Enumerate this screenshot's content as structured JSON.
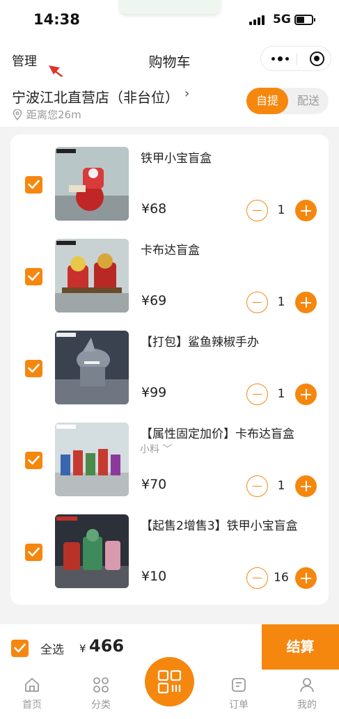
{
  "status_bar": {
    "time": "14:38",
    "network": "5G"
  },
  "nav": {
    "manage_label": "管理",
    "title": "购物车"
  },
  "store": {
    "name": "宁波江北直营店（非台位）",
    "chevron": "›",
    "distance": "距离您26m",
    "mode_pickup": "自提",
    "mode_delivery": "配送"
  },
  "cart": {
    "items": [
      {
        "name": "铁甲小宝盲盒",
        "spec": "",
        "price": "¥68",
        "qty": "1",
        "checked": true
      },
      {
        "name": "卡布达盲盒",
        "spec": "",
        "price": "¥69",
        "qty": "1",
        "checked": true
      },
      {
        "name": "【打包】鲨鱼辣椒手办",
        "spec": "",
        "price": "¥99",
        "qty": "1",
        "checked": true
      },
      {
        "name": "【属性固定加价】卡布达盲盒",
        "spec": "小料 ﹀",
        "price": "¥70",
        "qty": "1",
        "checked": true
      },
      {
        "name": "【起售2增售3】铁甲小宝盲盒",
        "spec": "",
        "price": "¥10",
        "qty": "16",
        "checked": true
      }
    ]
  },
  "footer": {
    "select_all_label": "全选",
    "total_symbol": "¥",
    "total_value": "466",
    "checkout_label": "结算"
  },
  "tabbar": {
    "home": "首页",
    "category": "分类",
    "orders": "订单",
    "mine": "我的"
  },
  "colors": {
    "accent": "#f5870f",
    "background": "#f3f3f3",
    "muted_text": "#9b9b9b"
  }
}
